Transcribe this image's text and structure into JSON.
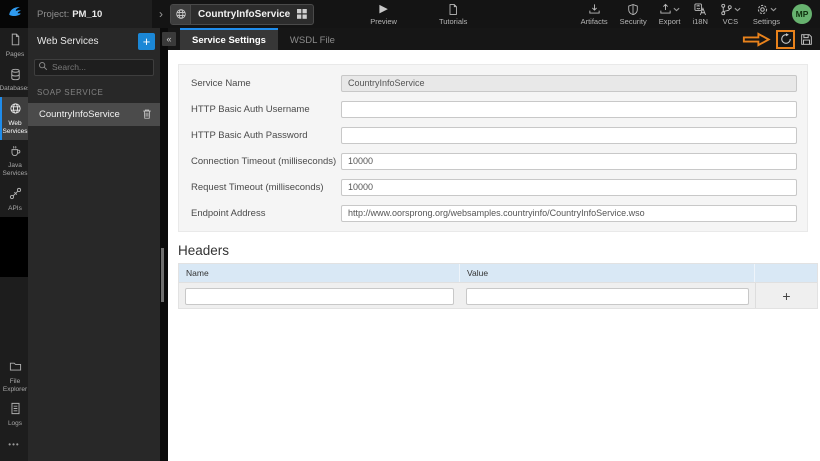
{
  "topbar": {
    "project_label": "Project:",
    "project_name": "PM_10",
    "service_name": "CountryInfoService",
    "preview_label": "Preview",
    "tutorials_label": "Tutorials",
    "right_items": [
      {
        "label": "Artifacts"
      },
      {
        "label": "Security"
      },
      {
        "label": "Export"
      },
      {
        "label": "i18N"
      },
      {
        "label": "VCS"
      },
      {
        "label": "Settings"
      }
    ],
    "avatar_initials": "MP"
  },
  "icons": {
    "play": "▶",
    "collapse": "«",
    "breadcrumb_chevron": "›",
    "more_dots": "•••"
  },
  "nav": {
    "items": [
      {
        "label": "Pages"
      },
      {
        "label": "Databases"
      },
      {
        "label": "Web Services",
        "active": true
      },
      {
        "label": "Java Services"
      },
      {
        "label": "APIs"
      },
      {
        "label": "File Explorer"
      },
      {
        "label": "Logs"
      }
    ]
  },
  "panel": {
    "title": "Web Services",
    "add_button": "+",
    "search_placeholder": "Search...",
    "section_label": "SOAP SERVICE",
    "items": [
      {
        "label": "CountryInfoService",
        "selected": true
      }
    ]
  },
  "tabs": [
    {
      "label": "Service Settings",
      "active": true
    },
    {
      "label": "WSDL File",
      "active": false
    }
  ],
  "form": {
    "fields": [
      {
        "label": "Service Name",
        "value": "CountryInfoService",
        "disabled": true
      },
      {
        "label": "HTTP Basic Auth Username",
        "value": ""
      },
      {
        "label": "HTTP Basic Auth Password",
        "value": ""
      },
      {
        "label": "Connection Timeout (milliseconds)",
        "value": "10000"
      },
      {
        "label": "Request Timeout (milliseconds)",
        "value": "10000"
      },
      {
        "label": "Endpoint Address",
        "value": "http://www.oorsprong.org/websamples.countryinfo/CountryInfoService.wso"
      }
    ]
  },
  "headers_section": {
    "title": "Headers",
    "columns": [
      "Name",
      "Value"
    ],
    "add_row_label": "+"
  },
  "colors": {
    "accent_blue": "#1f8ceb",
    "annotation_orange": "#e8821c",
    "avatar_green": "#67b26f",
    "table_header_blue": "#d9e8f5"
  }
}
